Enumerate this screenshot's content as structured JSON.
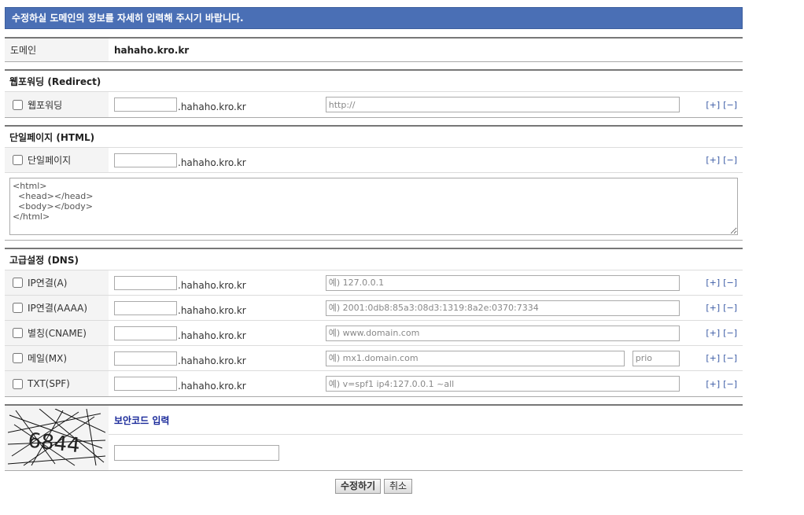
{
  "banner": "수정하실 도메인의 정보를 자세히 입력해 주시기 바랍니다.",
  "domain": {
    "label": "도메인",
    "value": "hahaho.kro.kr"
  },
  "suffix": ".hahaho.kro.kr",
  "plus": "[+]",
  "minus": "[−]",
  "redirect": {
    "section": "웹포워딩 (Redirect)",
    "label": "웹포워딩",
    "placeholder": "http://"
  },
  "html": {
    "section": "단일페이지 (HTML)",
    "label": "단일페이지",
    "content": "<html>\n  <head></head>\n  <body></body>\n</html>"
  },
  "dns": {
    "section": "고급설정 (DNS)",
    "records": [
      {
        "label": "IP연결(A)",
        "placeholder": "예) 127.0.0.1"
      },
      {
        "label": "IP연결(AAAA)",
        "placeholder": "예) 2001:0db8:85a3:08d3:1319:8a2e:0370:7334"
      },
      {
        "label": "별칭(CNAME)",
        "placeholder": "예) www.domain.com"
      },
      {
        "label": "메일(MX)",
        "placeholder": "예) mx1.domain.com",
        "prio_placeholder": "prio"
      },
      {
        "label": "TXT(SPF)",
        "placeholder": "예) v=spf1 ip4:127.0.0.1 ~all"
      }
    ]
  },
  "captcha": {
    "title": "보안코드 입력",
    "code": "6844"
  },
  "buttons": {
    "submit": "수정하기",
    "cancel": "취소"
  }
}
